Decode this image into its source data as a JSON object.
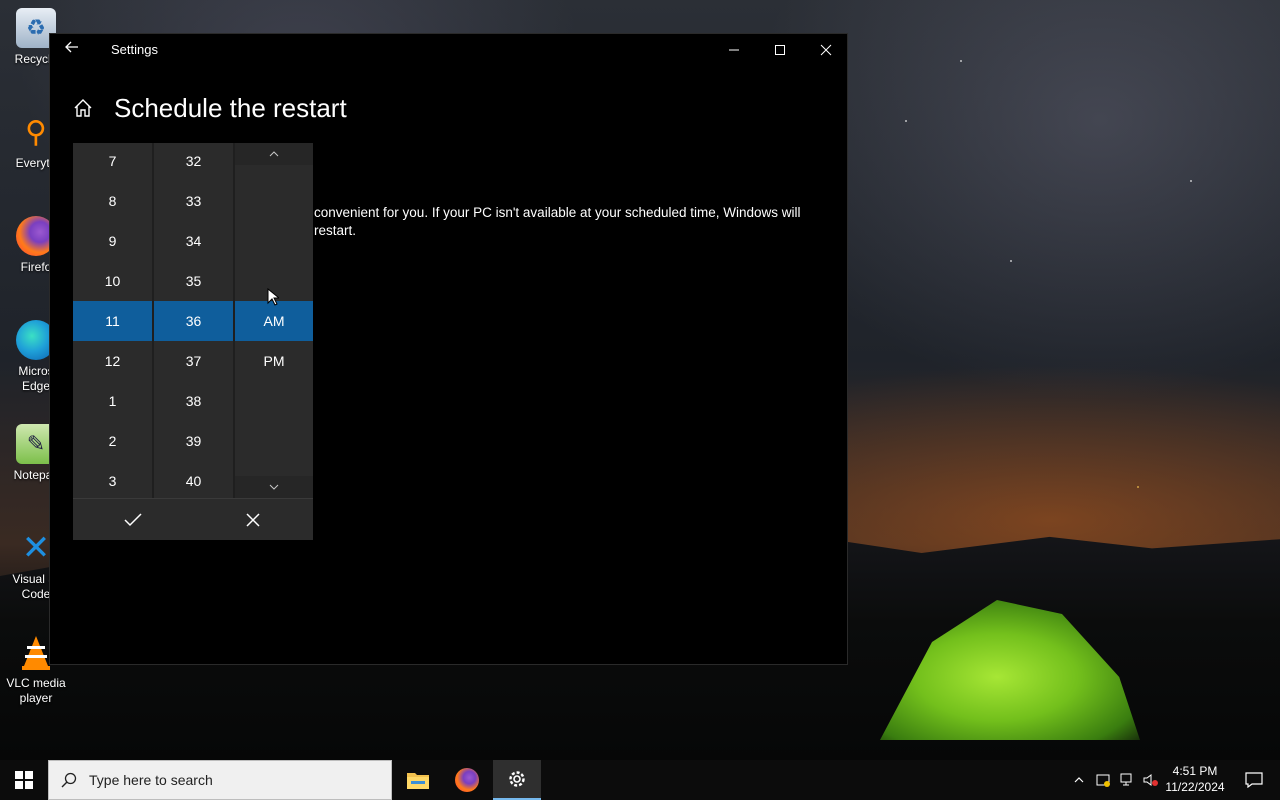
{
  "desktop": {
    "icons": [
      {
        "label": "Recycle",
        "icon": "recycle-bin-icon"
      },
      {
        "label": "Everyth",
        "icon": "everything-search-icon"
      },
      {
        "label": "Firefo",
        "icon": "firefox-icon"
      },
      {
        "label": "Micros\nEdge",
        "icon": "edge-icon"
      },
      {
        "label": "Notepac",
        "icon": "notepad-icon"
      },
      {
        "label": "Visual St\nCode",
        "icon": "vscode-icon"
      },
      {
        "label": "VLC media\nplayer",
        "icon": "vlc-icon"
      }
    ]
  },
  "window": {
    "app_title": "Settings",
    "page_title": "Schedule the restart",
    "description_line1": "convenient for you. If your PC isn't available at your scheduled time, Windows will",
    "description_line2": "restart."
  },
  "time_picker": {
    "hours": [
      "7",
      "8",
      "9",
      "10",
      "11",
      "12",
      "1",
      "2",
      "3"
    ],
    "minutes": [
      "32",
      "33",
      "34",
      "35",
      "36",
      "37",
      "38",
      "39",
      "40"
    ],
    "periods": [
      "AM",
      "PM"
    ],
    "selected": {
      "hour": "11",
      "minute": "36",
      "period": "AM"
    },
    "accept_icon": "checkmark-icon",
    "dismiss_icon": "close-icon"
  },
  "taskbar": {
    "search_placeholder": "Type here to search",
    "pinned": [
      {
        "name": "file-explorer",
        "icon": "folder-icon"
      },
      {
        "name": "firefox",
        "icon": "firefox-icon"
      },
      {
        "name": "settings",
        "icon": "gear-icon",
        "active": true
      }
    ],
    "clock_time": "4:51 PM",
    "clock_date": "11/22/2024"
  },
  "colors": {
    "accent": "#0f5e9c",
    "window_bg": "#000000",
    "picker_bg": "#2b2b2b",
    "taskbar_bg": "#0c0c0c"
  }
}
